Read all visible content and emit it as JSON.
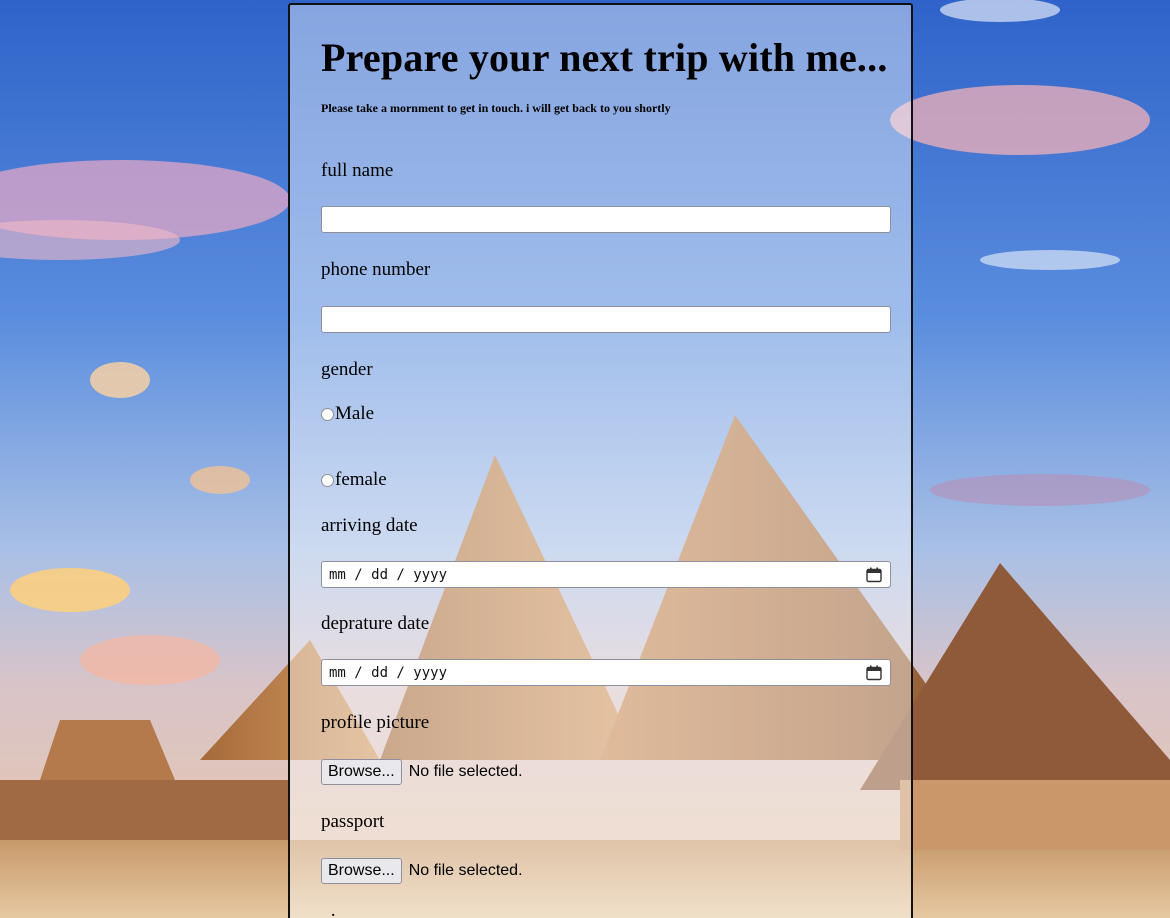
{
  "form": {
    "title": "Prepare your next trip with me...",
    "subtitle": "Please take a mornment to get in touch. i will get back to you shortly",
    "full_name_label": "full name",
    "full_name_value": "",
    "phone_label": "phone number",
    "phone_value": "",
    "gender_label": "gender",
    "gender_options": [
      "Male",
      "female"
    ],
    "arriving_label": "arriving date",
    "arriving_placeholder": "mm / dd / yyyy",
    "departure_label": "deprature date",
    "departure_placeholder": "mm / dd / yyyy",
    "profile_label": "profile picture",
    "passport_label": "passport",
    "browse_label": "Browse...",
    "no_file_text": "No file selected.",
    "cutoff_text": "·"
  },
  "icons": {
    "date_picker": "calendar-icon"
  },
  "colors": {
    "card_border": "#111111",
    "input_border": "#8f8f9d",
    "button_bg": "#e9e9ed"
  }
}
